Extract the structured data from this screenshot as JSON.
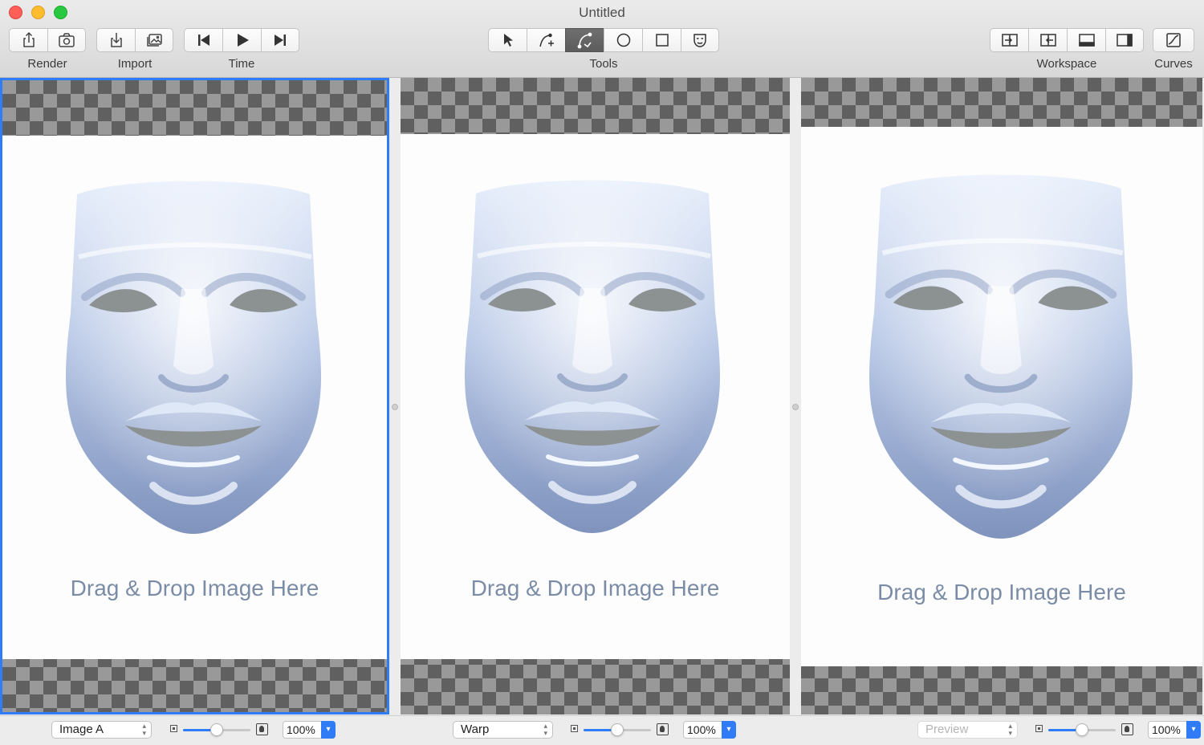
{
  "window": {
    "title": "Untitled"
  },
  "toolbar": {
    "groups": [
      {
        "label": "Render",
        "buttons": [
          "share-icon",
          "camera-icon"
        ]
      },
      {
        "label": "Import",
        "buttons": [
          "import-icon",
          "image-icon"
        ]
      },
      {
        "label": "Time",
        "buttons": [
          "skip-back-icon",
          "play-icon",
          "skip-forward-icon"
        ]
      },
      {
        "label": "Tools",
        "buttons": [
          "arrow-pointer-icon",
          "add-curve-icon",
          "curve-edit-icon",
          "circle-icon",
          "square-icon",
          "mask-face-icon"
        ],
        "active": "curve-edit-icon"
      },
      {
        "label": "Workspace",
        "buttons": [
          "panel-right-in-icon",
          "panel-left-out-icon",
          "bottom-panel-icon",
          "right-sidebar-icon"
        ]
      },
      {
        "label": "Curves",
        "buttons": [
          "curves-chart-icon"
        ]
      }
    ]
  },
  "panes": [
    {
      "id": "image-a",
      "drop_text": "Drag & Drop Image Here",
      "select_value": "Image A",
      "zoom": "100%",
      "slider_value": 0.5,
      "select_disabled": false
    },
    {
      "id": "warp",
      "drop_text": "Drag & Drop Image Here",
      "select_value": "Warp",
      "zoom": "100%",
      "slider_value": 0.5,
      "select_disabled": false
    },
    {
      "id": "preview",
      "drop_text": "Drag & Drop Image Here",
      "select_value": "Preview",
      "zoom": "100%",
      "slider_value": 0.5,
      "select_disabled": true
    }
  ],
  "colors": {
    "accent": "#2f7cf6",
    "drop_text": "#7b8ca6",
    "mask_light": "#e6eefb",
    "mask_dark": "#7f93bd"
  }
}
